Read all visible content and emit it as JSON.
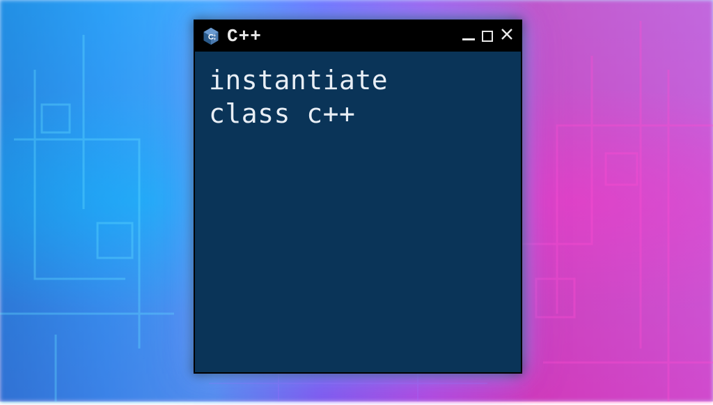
{
  "window": {
    "title": "C++",
    "content_line1": "instantiate",
    "content_line2": "class c++"
  },
  "colors": {
    "window_bg": "#0a3458",
    "titlebar_bg": "#000000",
    "text": "#e8eef5",
    "logo_blue": "#5c9fd6",
    "logo_dark": "#1a4a7a"
  }
}
